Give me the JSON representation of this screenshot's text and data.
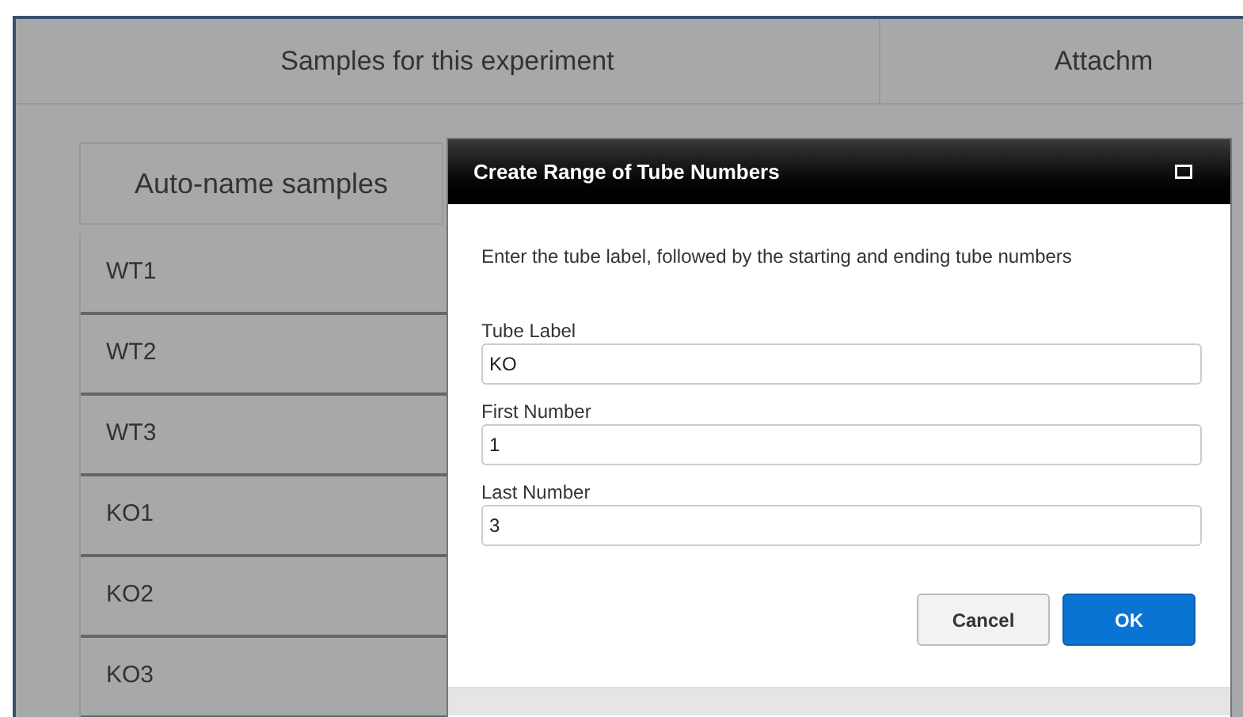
{
  "tabs": [
    {
      "label": "Samples for this experiment"
    },
    {
      "label": "Attachm"
    }
  ],
  "auto_name_button": "Auto-name samples",
  "samples": [
    "WT1",
    "WT2",
    "WT3",
    "KO1",
    "KO2",
    "KO3"
  ],
  "dialog": {
    "title": "Create Range of Tube Numbers",
    "instructions": "Enter the tube label, followed by the starting and ending tube numbers",
    "fields": [
      {
        "label": "Tube Label",
        "value": "KO"
      },
      {
        "label": "First Number",
        "value": "1"
      },
      {
        "label": "Last Number",
        "value": "3"
      }
    ],
    "buttons": [
      {
        "label": "Cancel",
        "kind": "secondary"
      },
      {
        "label": "OK",
        "kind": "primary"
      }
    ]
  }
}
